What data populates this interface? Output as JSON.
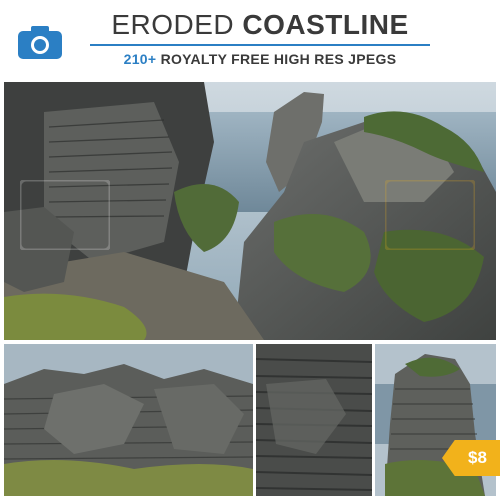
{
  "header": {
    "title_light": "ERODED",
    "title_bold": "COASTLINE",
    "subtitle_count": "210+",
    "subtitle_rest": "ROYALTY FREE HIGH RES JPEGS"
  },
  "badge": {
    "price": "$8"
  },
  "icons": {
    "camera": "camera-icon"
  },
  "colors": {
    "accent": "#2b7fc4",
    "badge": "#f2b21b",
    "title": "#3a3a3a"
  }
}
